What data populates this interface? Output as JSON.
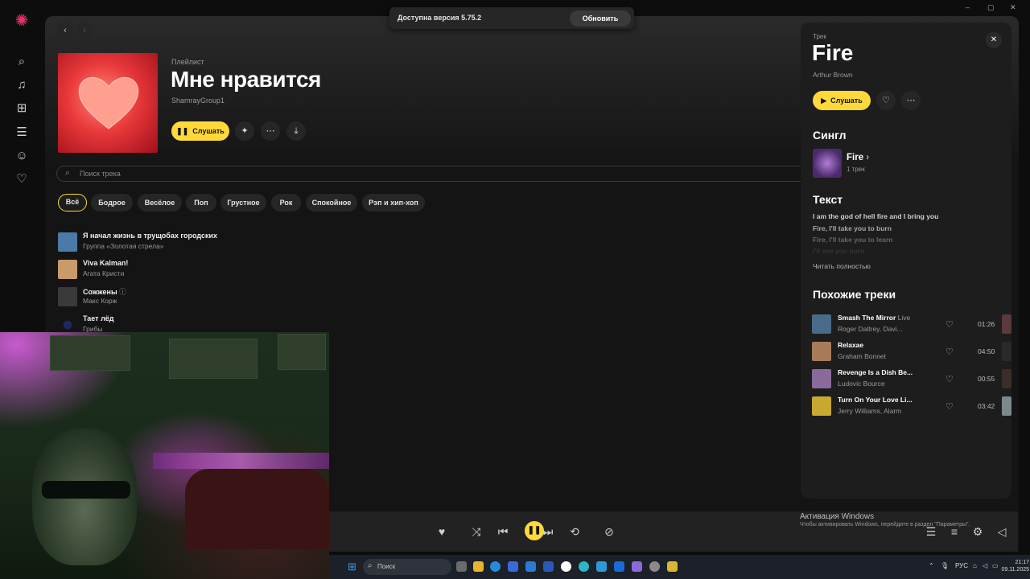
{
  "app": {
    "nav_icons": [
      "logo-icon",
      "search-icon",
      "music-icon",
      "books-icon",
      "podcasts-icon",
      "kids-icon",
      "heart-icon"
    ]
  },
  "notification": {
    "text": "Доступна версия 5.75.2",
    "button": "Обновить"
  },
  "playlist": {
    "type_label": "Плейлист",
    "title": "Мне нравится",
    "owner": "ShamrayGroup1",
    "play_label": "Слушать"
  },
  "search": {
    "placeholder": "Поиск трека"
  },
  "chips": [
    "Всё",
    "Бодрое",
    "Весёлое",
    "Поп",
    "Грустное",
    "Рок",
    "Спокойное",
    "Рэп и хип-хоп"
  ],
  "tracks": [
    {
      "title": "Я начал жизнь в трущобах городских",
      "artist": "Группа «Золотая стрела»",
      "color": "#4a7aa8"
    },
    {
      "title": "Viva Kalman!",
      "artist": "Агата Кристи",
      "color": "#c99a6a"
    },
    {
      "title": "Сожжены",
      "artist": "Макс Корж",
      "color": "#3a3a3a"
    },
    {
      "title": "Тает лёд",
      "artist": "Грибы",
      "color": "#1a2a5a"
    }
  ],
  "track_panel": {
    "type_label": "Трек",
    "title": "Fire",
    "artist": "Arthur Brown",
    "play_label": "Слушать",
    "single_heading": "Сингл",
    "single_title": "Fire",
    "single_count": "1 трек",
    "lyrics_heading": "Текст",
    "lyrics": [
      "I am the god of hell fire and I bring you",
      "Fire, I'll take you to burn",
      "Fire, I'll take you to learn",
      "I'll see you burn"
    ],
    "read_full": "Читать полностью",
    "similar_heading": "Похожие треки",
    "similar": [
      {
        "title": "Smash The Mirror",
        "tag": "Live",
        "artist": "Roger Daltrey, Davi...",
        "duration": "01:26",
        "color": "#4a6a8a"
      },
      {
        "title": "Relaxae",
        "tag": "",
        "artist": "Graham Bonnet",
        "duration": "04:50",
        "color": "#a87a5a"
      },
      {
        "title": "Revenge Is a Dish Be...",
        "tag": "",
        "artist": "Ludovic Bource",
        "duration": "00:55",
        "color": "#8a6a9a"
      },
      {
        "title": "Turn On Your Love Li...",
        "tag": "",
        "artist": "Jerry Williams, Alarm",
        "duration": "03:42",
        "color": "#c8a830"
      }
    ]
  },
  "activation": {
    "line1": "Активация Windows",
    "line2": "Чтобы активировать Windows, перейдите в раздел \"Параметры\"."
  },
  "taskbar": {
    "search_placeholder": "Поиск",
    "lang": "РУС",
    "time": "21:17",
    "date": "09.11.2025"
  }
}
